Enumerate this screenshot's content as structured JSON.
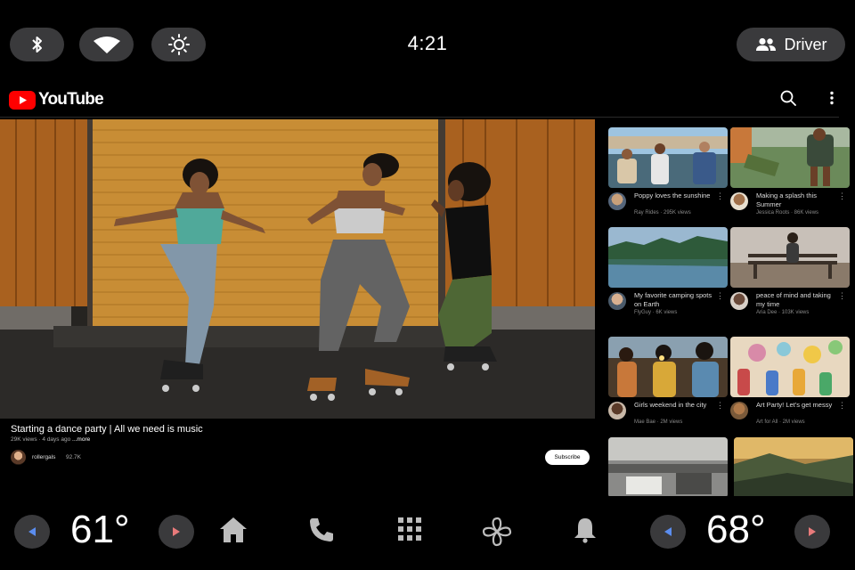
{
  "status": {
    "time": "4:21",
    "driver_label": "Driver",
    "icons": [
      "bluetooth-icon",
      "wifi-icon",
      "brightness-icon",
      "person-icon"
    ]
  },
  "youtube": {
    "logo_text": "YouTube",
    "main_video": {
      "title": "Starting a dance party | All we need is music",
      "meta": "29K views · 4 days ago",
      "more": "...more",
      "channel": "rollergals",
      "subscribers": "92.7K",
      "subscribe_label": "Subscribe"
    },
    "recommended": [
      {
        "title": "Poppy loves the sunshine",
        "meta": "Ray Rides · 295K views"
      },
      {
        "title": "Making a splash this Summer",
        "meta": "Jessica Roots · 86K views"
      },
      {
        "title": "My favorite camping spots on Earth",
        "meta": "FlyGuy · 6K views"
      },
      {
        "title": "peace of mind and taking my time",
        "meta": "Aria Dee · 103K views"
      },
      {
        "title": "Girls weekend in the city",
        "meta": "Mae Bae · 2M views"
      },
      {
        "title": "Art Party! Let's get messy",
        "meta": "Art for All · 2M views"
      }
    ]
  },
  "dock": {
    "left_temp": "61°",
    "right_temp": "68°",
    "icons": [
      "home-icon",
      "phone-icon",
      "apps-grid-icon",
      "fan-icon",
      "bell-icon"
    ],
    "arrow_left_color": "#5b8def",
    "arrow_right_color": "#e87a7a"
  }
}
